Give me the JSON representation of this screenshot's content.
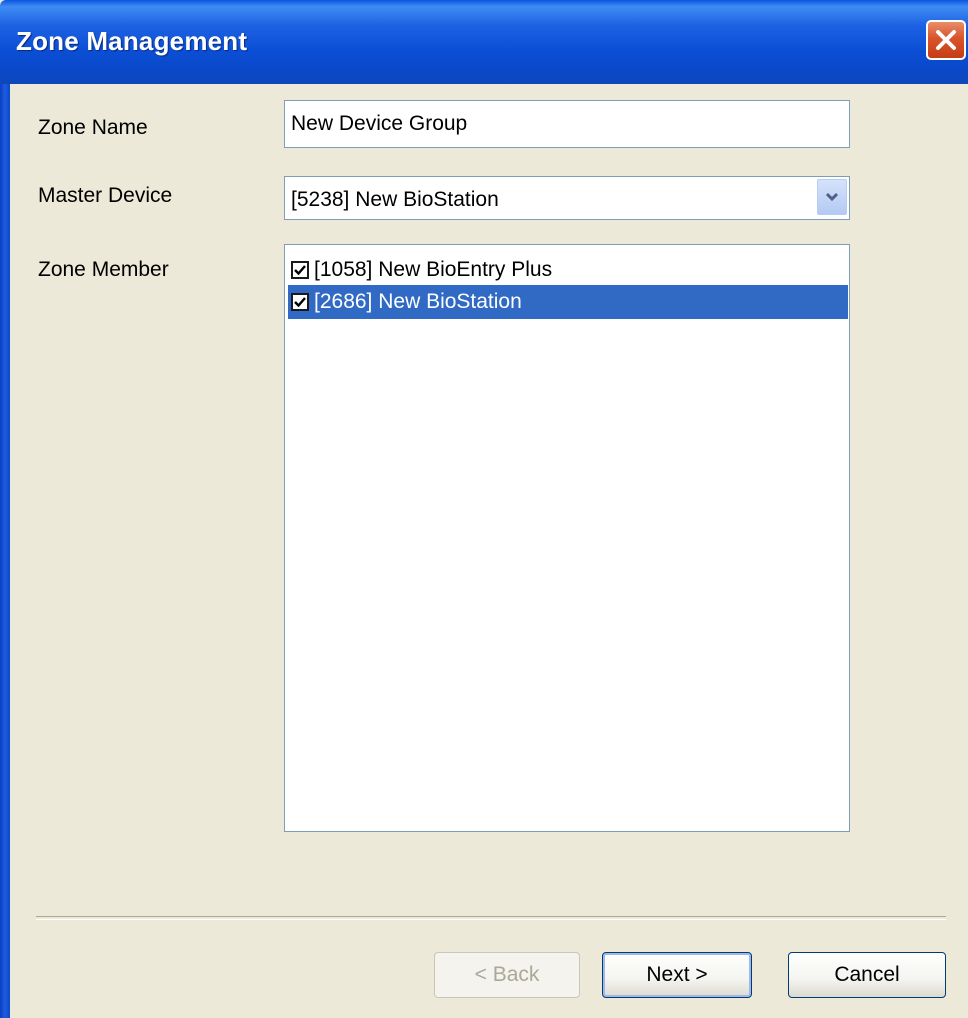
{
  "window": {
    "title": "Zone Management"
  },
  "form": {
    "zone_name_label": "Zone Name",
    "zone_name_value": "New Device Group",
    "master_device_label": "Master Device",
    "master_device_value": "[5238] New BioStation",
    "zone_member_label": "Zone Member",
    "members": [
      {
        "label": "[1058] New BioEntry Plus",
        "checked": true,
        "selected": false
      },
      {
        "label": "[2686] New BioStation",
        "checked": true,
        "selected": true
      }
    ]
  },
  "buttons": {
    "back": "< Back",
    "next": "Next >",
    "cancel": "Cancel"
  },
  "colors": {
    "titlebar": "#0a48c8",
    "dialog_background": "#ece9d8",
    "selection": "#316ac5",
    "close_button": "#d9542c"
  }
}
